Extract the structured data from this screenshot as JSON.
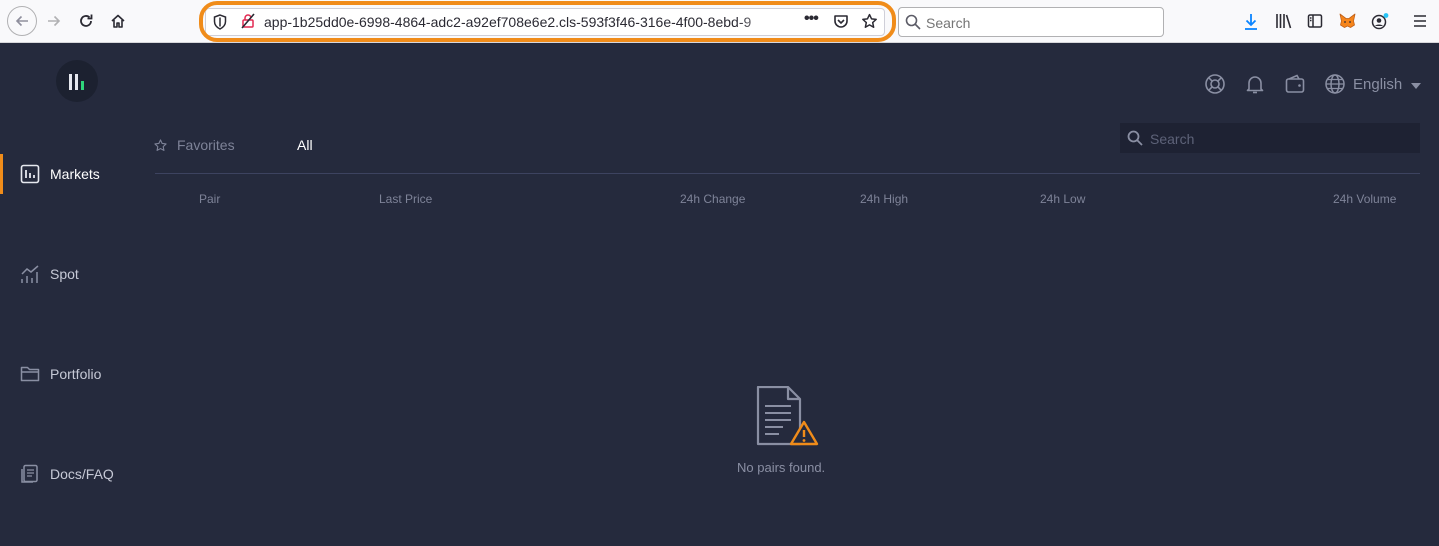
{
  "browser": {
    "url": "app-1b25dd0e-6998-4864-adc2-a92ef708e6e2.cls-593f3f46-316e-4f00-8ebd-9",
    "search_placeholder": "Search",
    "highlight_color": "#f08c1a"
  },
  "app": {
    "language": "English",
    "sidebar": {
      "items": [
        {
          "label": "Markets",
          "icon": "chart-icon",
          "active": true
        },
        {
          "label": "Spot",
          "icon": "trend-icon",
          "active": false
        },
        {
          "label": "Portfolio",
          "icon": "folder-icon",
          "active": false
        },
        {
          "label": "Docs/FAQ",
          "icon": "docs-icon",
          "active": false
        }
      ]
    },
    "markets": {
      "tabs": [
        {
          "label": "Favorites",
          "icon": "star-icon",
          "active": false
        },
        {
          "label": "All",
          "active": true
        }
      ],
      "search_placeholder": "Search",
      "columns": [
        "Pair",
        "Last Price",
        "24h Change",
        "24h High",
        "24h Low",
        "24h Volume"
      ],
      "empty_message": "No pairs found."
    },
    "colors": {
      "background": "#252a3d",
      "accent": "#f08c1a",
      "logo_green": "#2fd67b"
    }
  }
}
